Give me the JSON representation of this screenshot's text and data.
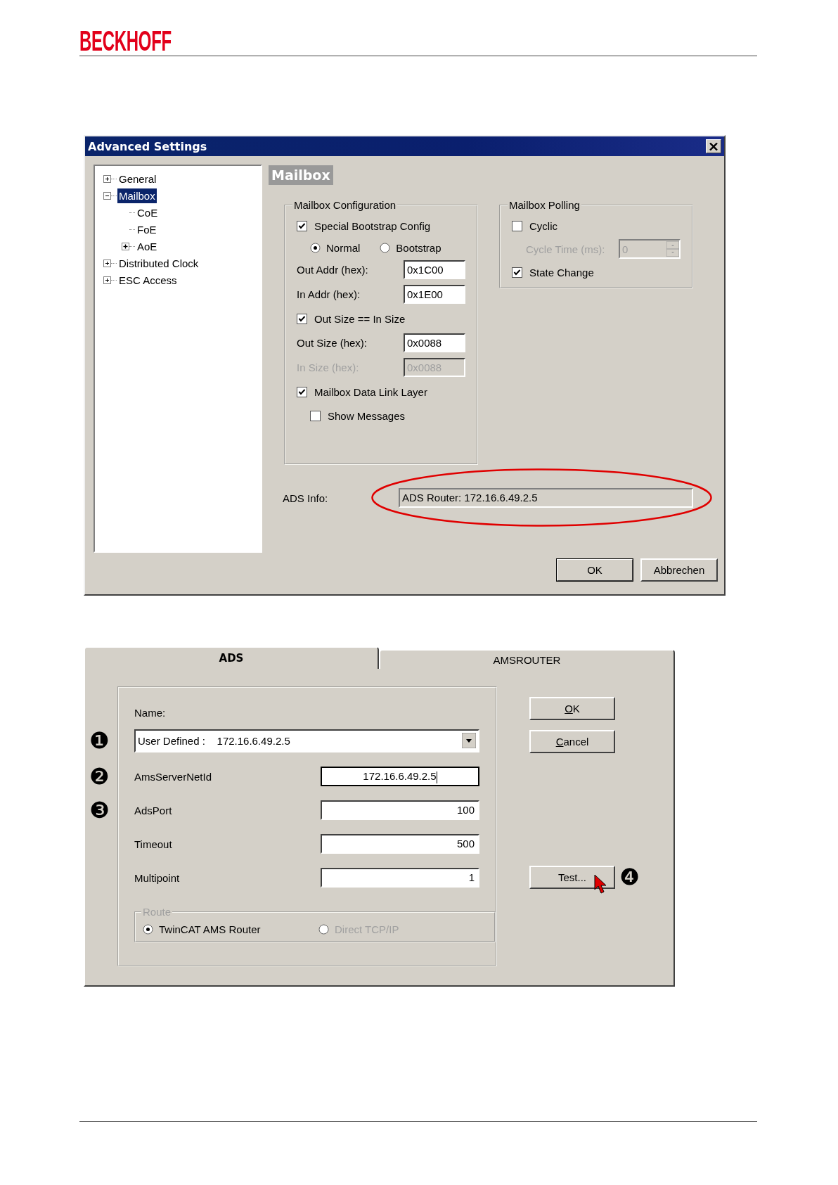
{
  "header": {
    "logo": "BECKHOFF"
  },
  "advanced_settings": {
    "title": "Advanced Settings",
    "tree": [
      {
        "label": "General",
        "kind": "branch",
        "expanded": false,
        "selected": false
      },
      {
        "label": "Mailbox",
        "kind": "branch",
        "expanded": true,
        "selected": true,
        "children": [
          {
            "label": "CoE",
            "kind": "leaf",
            "selected": false
          },
          {
            "label": "FoE",
            "kind": "leaf",
            "selected": false
          },
          {
            "label": "AoE",
            "kind": "branch",
            "expanded": false,
            "selected": false
          }
        ]
      },
      {
        "label": "Distributed Clock",
        "kind": "branch",
        "expanded": false,
        "selected": false
      },
      {
        "label": "ESC Access",
        "kind": "branch",
        "expanded": false,
        "selected": false
      }
    ],
    "section_title": "Mailbox",
    "groups": [
      {
        "title": "Mailbox Configuration",
        "rows": [
          {
            "kind": "checkbox",
            "label": "Special Bootstrap Config",
            "checked": true
          },
          {
            "kind": "radios",
            "options": [
              {
                "label": "Normal",
                "selected": true
              },
              {
                "label": "Bootstrap",
                "selected": false
              }
            ]
          },
          {
            "kind": "field",
            "label": "Out Addr (hex):",
            "value": "0x1C00",
            "disabled": false
          },
          {
            "kind": "field",
            "label": "In Addr (hex):",
            "value": "0x1E00",
            "disabled": false
          },
          {
            "kind": "checkbox",
            "label": "Out Size == In Size",
            "checked": true
          },
          {
            "kind": "field",
            "label": "Out Size (hex):",
            "value": "0x0088",
            "disabled": false
          },
          {
            "kind": "field",
            "label": "In Size (hex):",
            "value": "0x0088",
            "disabled": true
          },
          {
            "kind": "checkbox",
            "label": "Mailbox Data Link Layer",
            "checked": true,
            "children": [
              {
                "label": "Show Messages",
                "checked": false
              }
            ]
          }
        ]
      },
      {
        "title": "Mailbox Polling",
        "rows": [
          {
            "kind": "checkbox",
            "label": "Cyclic",
            "checked": false
          },
          {
            "kind": "spin",
            "label": "Cycle Time (ms):",
            "value": "0",
            "disabled": true
          },
          {
            "kind": "checkbox",
            "label": "State Change",
            "checked": true
          }
        ]
      }
    ],
    "ads_info": {
      "label": "ADS Info:",
      "value": "ADS Router: 172.16.6.49.2.5",
      "highlighted": true
    },
    "buttons": [
      {
        "label": "OK",
        "default": true
      },
      {
        "label": "Abbrechen",
        "default": false
      }
    ]
  },
  "ads_dialog": {
    "tabs": [
      {
        "label": "ADS",
        "selected": true
      },
      {
        "label": "AMSROUTER",
        "selected": false
      }
    ],
    "name_label": "Name:",
    "name_combo": {
      "value": "User Defined :    172.16.6.49.2.5",
      "marker": "❶"
    },
    "fields": [
      {
        "label": "AmsServerNetId",
        "value": "172.16.6.49.2.5",
        "focused": true,
        "marker": "❷"
      },
      {
        "label": "AdsPort",
        "value": "100",
        "focused": false,
        "marker": "❸"
      },
      {
        "label": "Timeout",
        "value": "500",
        "focused": false
      },
      {
        "label": "Multipoint",
        "value": "1",
        "focused": false
      }
    ],
    "route": {
      "title": "Route",
      "options": [
        {
          "label": "TwinCAT AMS Router",
          "selected": true,
          "disabled": false
        },
        {
          "label": "Direct TCP/IP",
          "selected": false,
          "disabled": true
        }
      ]
    },
    "buttons": [
      {
        "label": "OK",
        "underline_first": true
      },
      {
        "label": "Cancel",
        "underline_first": true
      },
      {
        "label": "Test...",
        "underline_first": false,
        "marker": "❹",
        "pointer": true
      }
    ]
  }
}
